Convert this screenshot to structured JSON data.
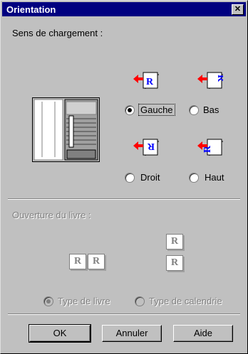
{
  "dialog": {
    "title": "Orientation",
    "close_symbol": "✕"
  },
  "feed": {
    "section_label": "Sens de chargement :",
    "options": {
      "left": "Gauche",
      "bottom": "Bas",
      "right": "Droit",
      "top": "Haut"
    },
    "selected": "Gauche"
  },
  "binding": {
    "section_label": "Ouverture du livre :",
    "book_letter": "R",
    "options": {
      "book": "Type de livre",
      "calendar": "Type de calendrie"
    },
    "selected": "Type de livre"
  },
  "buttons": {
    "ok": "OK",
    "cancel": "Annuler",
    "help": "Aide"
  },
  "colors": {
    "titlebar": "#000080",
    "arrow": "#ff0000",
    "letter": "#0000ff",
    "face": "#c0c0c0"
  }
}
